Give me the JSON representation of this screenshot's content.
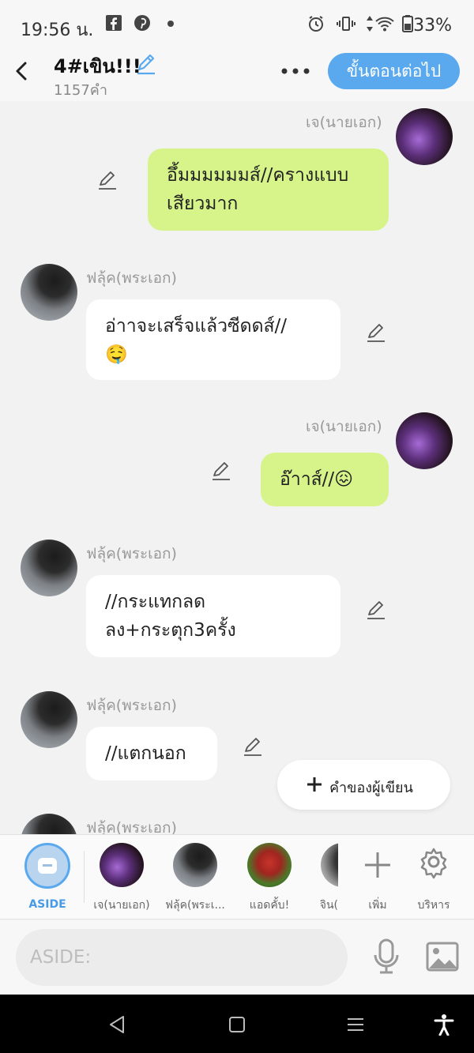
{
  "status_bar": {
    "time": "19:56 น.",
    "icons": [
      "facebook-icon",
      "pinterest-icon",
      "dot-icon",
      "alarm-icon",
      "vibrate-icon",
      "data-arrows-icon",
      "wifi-icon",
      "battery-icon"
    ],
    "battery": "33%"
  },
  "header": {
    "title": "4#เขิน!!!",
    "word_count": "1157คำ",
    "next_label": "ขั้นตอนต่อไป"
  },
  "messages": [
    {
      "sender": "เจ(นายเอก)",
      "text_lines": [
        "อึ้มมมมมมส์//ครางแบบ",
        "เสียวมาก"
      ],
      "side": "right"
    },
    {
      "sender": "ฟลุ้ค(พระเอก)",
      "text_lines": [
        "อ่าาจะเสร็จแล้วซีดดส์//",
        "🤤"
      ],
      "side": "left"
    },
    {
      "sender": "เจ(นายเอก)",
      "text_lines": [
        "อ๊าาส์//😖"
      ],
      "side": "right"
    },
    {
      "sender": "ฟลุ้ค(พระเอก)",
      "text_lines": [
        "//กระแทกลด",
        "ลง+กระตุก3ครั้ง"
      ],
      "side": "left"
    },
    {
      "sender": "ฟลุ้ค(พระเอก)",
      "text_lines": [
        "//แตกนอก"
      ],
      "side": "left"
    },
    {
      "sender": "ฟลุ้ค(พระเอก)",
      "text_lines": [],
      "side": "left"
    }
  ],
  "aside_popup": {
    "label": "คำของผู้เขียน"
  },
  "characters": [
    {
      "label": "ASIDE"
    },
    {
      "label": "เจ(นายเอก)"
    },
    {
      "label": "ฟลุ้ค(พระเ..."
    },
    {
      "label": "แอดคั้บ!"
    },
    {
      "label": "จิน("
    },
    {
      "label": "เพิ่ม"
    },
    {
      "label": "บริหาร"
    }
  ],
  "input": {
    "placeholder": "ASIDE:"
  },
  "colors": {
    "accent": "#5aa9ef",
    "bubble_green": "#d6f48a",
    "bubble_white": "#ffffff",
    "background": "#f2f2f2"
  }
}
